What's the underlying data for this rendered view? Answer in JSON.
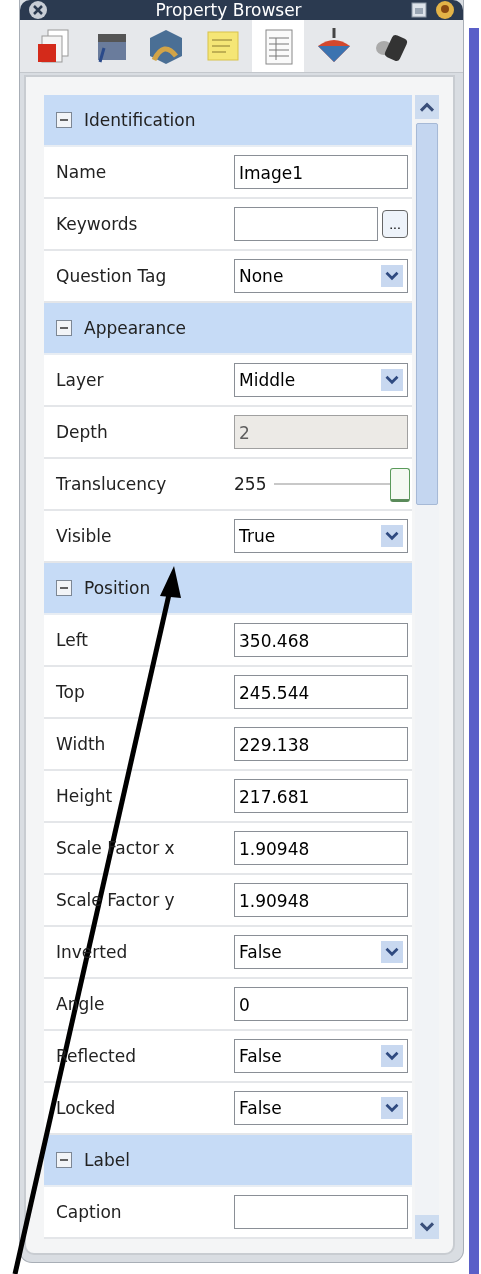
{
  "window": {
    "title": "Property Browser"
  },
  "toolbar": [
    {
      "selected": false
    },
    {
      "selected": false
    },
    {
      "selected": false
    },
    {
      "selected": false
    },
    {
      "selected": true
    },
    {
      "selected": false
    },
    {
      "selected": false
    }
  ],
  "sections": [
    {
      "title": "Identification",
      "expanded": true,
      "rows": [
        {
          "kind": "text",
          "label": "Name",
          "value": "Image1"
        },
        {
          "kind": "text_button",
          "label": "Keywords",
          "value": "",
          "button": "..."
        },
        {
          "kind": "dropdown",
          "label": "Question Tag",
          "value": "None"
        }
      ]
    },
    {
      "title": "Appearance",
      "expanded": true,
      "rows": [
        {
          "kind": "dropdown",
          "label": "Layer",
          "value": "Middle"
        },
        {
          "kind": "disabled",
          "label": "Depth",
          "value": "2"
        },
        {
          "kind": "slider",
          "label": "Translucency",
          "value": "255",
          "level": 1.0
        },
        {
          "kind": "dropdown",
          "label": "Visible",
          "value": "True"
        }
      ]
    },
    {
      "title": "Position",
      "expanded": true,
      "rows": [
        {
          "kind": "text",
          "label": "Left",
          "value": "350.468"
        },
        {
          "kind": "text",
          "label": "Top",
          "value": "245.544"
        },
        {
          "kind": "text",
          "label": "Width",
          "value": "229.138"
        },
        {
          "kind": "text",
          "label": "Height",
          "value": "217.681"
        },
        {
          "kind": "text",
          "label": "Scale Factor x",
          "value": "1.90948"
        },
        {
          "kind": "text",
          "label": "Scale Factor y",
          "value": "1.90948"
        },
        {
          "kind": "dropdown",
          "label": "Inverted",
          "value": "False"
        },
        {
          "kind": "text",
          "label": "Angle",
          "value": "0"
        },
        {
          "kind": "dropdown",
          "label": "Reflected",
          "value": "False"
        },
        {
          "kind": "dropdown",
          "label": "Locked",
          "value": "False"
        }
      ]
    },
    {
      "title": "Label",
      "expanded": true,
      "rows": [
        {
          "kind": "text",
          "label": "Caption",
          "value": ""
        }
      ]
    }
  ]
}
